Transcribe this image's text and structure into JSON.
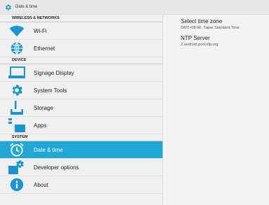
{
  "window": {
    "title": "Date & time"
  },
  "sidebar": {
    "sections": [
      {
        "header": "WIRELESS & NETWORKS",
        "items": [
          {
            "label": "Wi-Fi",
            "icon": "wifi-icon"
          },
          {
            "label": "Ethernet",
            "icon": "ethernet-icon"
          }
        ]
      },
      {
        "header": "DEVICE",
        "items": [
          {
            "label": "Signage Display",
            "icon": "display-icon"
          },
          {
            "label": "System Tools",
            "icon": "gear-icon"
          },
          {
            "label": "Storage",
            "icon": "storage-icon"
          },
          {
            "label": "Apps",
            "icon": "apps-icon"
          }
        ]
      },
      {
        "header": "SYSTEM",
        "items": [
          {
            "label": "Date & time",
            "icon": "clock-icon",
            "selected": true
          },
          {
            "label": "Developer options",
            "icon": "developer-icon"
          },
          {
            "label": "About",
            "icon": "info-icon"
          }
        ]
      }
    ]
  },
  "detail": {
    "preferences": [
      {
        "title": "Select time zone",
        "summary": "GMT+08:00, Taipei Standard Time"
      },
      {
        "title": "NTP Server",
        "summary": "2.android.pool.ntp.org"
      }
    ]
  },
  "colors": {
    "accent": "#1fa7d6",
    "icon_blue": "#1996d1"
  }
}
